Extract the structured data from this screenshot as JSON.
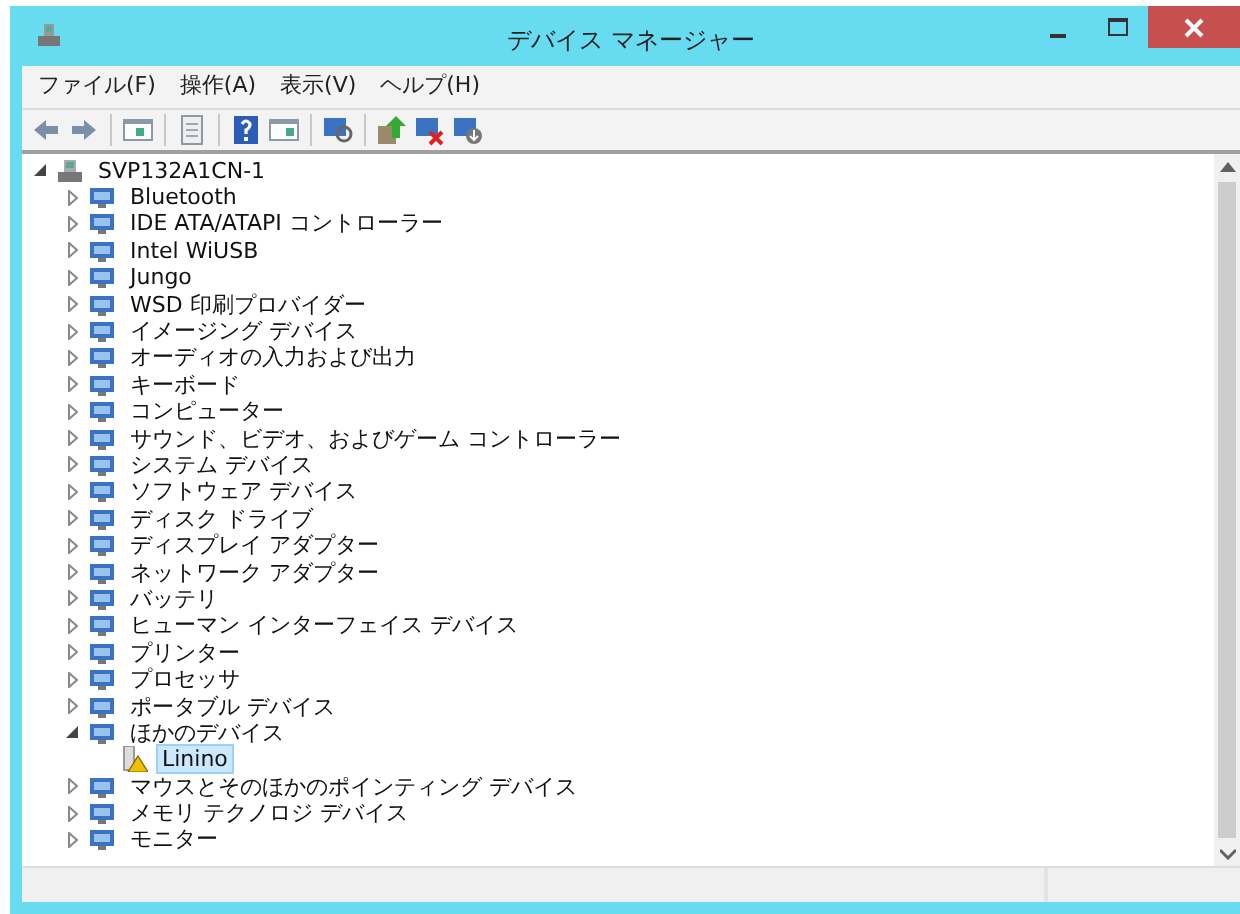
{
  "window": {
    "title": "デバイス マネージャー"
  },
  "menu": [
    "ファイル(F)",
    "操作(A)",
    "表示(V)",
    "ヘルプ(H)"
  ],
  "tree": {
    "label": "SVP132A1CN-1",
    "expanded": true,
    "children": [
      {
        "label": "Bluetooth",
        "expanded": false,
        "selected": false
      },
      {
        "label": "IDE ATA/ATAPI コントローラー",
        "expanded": false,
        "selected": false
      },
      {
        "label": "Intel WiUSB",
        "expanded": false,
        "selected": false
      },
      {
        "label": "Jungo",
        "expanded": false,
        "selected": false
      },
      {
        "label": "WSD 印刷プロバイダー",
        "expanded": false,
        "selected": false
      },
      {
        "label": "イメージング デバイス",
        "expanded": false,
        "selected": false
      },
      {
        "label": "オーディオの入力および出力",
        "expanded": false,
        "selected": false
      },
      {
        "label": "キーボード",
        "expanded": false,
        "selected": false
      },
      {
        "label": "コンピューター",
        "expanded": false,
        "selected": false
      },
      {
        "label": "サウンド、ビデオ、およびゲーム コントローラー",
        "expanded": false,
        "selected": false
      },
      {
        "label": "システム デバイス",
        "expanded": false,
        "selected": false
      },
      {
        "label": "ソフトウェア デバイス",
        "expanded": false,
        "selected": false
      },
      {
        "label": "ディスク ドライブ",
        "expanded": false,
        "selected": false
      },
      {
        "label": "ディスプレイ アダプター",
        "expanded": false,
        "selected": false
      },
      {
        "label": "ネットワーク アダプター",
        "expanded": false,
        "selected": false
      },
      {
        "label": "バッテリ",
        "expanded": false,
        "selected": false
      },
      {
        "label": "ヒューマン インターフェイス デバイス",
        "expanded": false,
        "selected": false
      },
      {
        "label": "プリンター",
        "expanded": false,
        "selected": false
      },
      {
        "label": "プロセッサ",
        "expanded": false,
        "selected": false
      },
      {
        "label": "ポータブル デバイス",
        "expanded": false,
        "selected": false
      },
      {
        "label": "ほかのデバイス",
        "expanded": true,
        "selected": false,
        "children": [
          {
            "label": "Linino",
            "selected": true,
            "warning": true
          }
        ]
      },
      {
        "label": "マウスとそのほかのポインティング デバイス",
        "expanded": false,
        "selected": false
      },
      {
        "label": "メモリ テクノロジ デバイス",
        "expanded": false,
        "selected": false
      },
      {
        "label": "モニター",
        "expanded": false,
        "selected": false
      }
    ]
  }
}
